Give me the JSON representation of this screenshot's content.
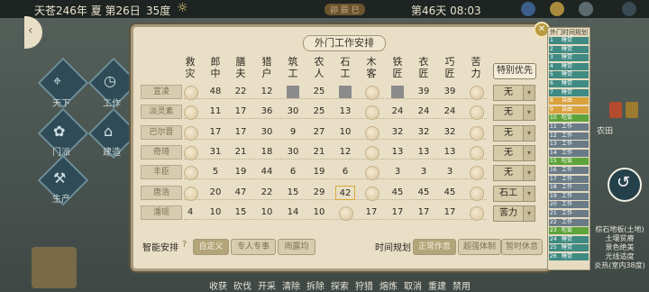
{
  "topbar": {
    "date": "天苍246年 夏 第26日",
    "temperature": "35度",
    "day_time": "第46天 08:03",
    "banner": "卯 辰 巳"
  },
  "left_nav": [
    {
      "label": "天下",
      "icon": "map-icon"
    },
    {
      "label": "工作",
      "icon": "clock-icon"
    },
    {
      "label": "门派",
      "icon": "sect-icon"
    },
    {
      "label": "建造",
      "icon": "building-icon"
    },
    {
      "label": "生产",
      "icon": "hammer-icon"
    }
  ],
  "panel": {
    "title": "外门工作安排",
    "special_header": "特别优先",
    "columns": [
      "救\n灾",
      "郎\n中",
      "膳\n夫",
      "猎\n户",
      "筑\n工",
      "农\n人",
      "石\n工",
      "木\n客",
      "铁\n匠",
      "衣\n匠",
      "巧\n匠",
      "苦\n力"
    ],
    "rows": [
      {
        "name": "宣凌",
        "values": [
          "0",
          "48",
          "22",
          "12",
          "X",
          "25",
          "X",
          "0",
          "X",
          "39",
          "39",
          "0"
        ],
        "special": "无"
      },
      {
        "name": "淡灵素",
        "values": [
          "0",
          "11",
          "17",
          "36",
          "30",
          "25",
          "13",
          "0",
          "24",
          "24",
          "24",
          "0"
        ],
        "special": "无"
      },
      {
        "name": "巴尔晋",
        "values": [
          "0",
          "17",
          "17",
          "30",
          "9",
          "27",
          "10",
          "0",
          "32",
          "32",
          "32",
          "0"
        ],
        "special": "无"
      },
      {
        "name": "奇琦",
        "values": [
          "0",
          "31",
          "21",
          "18",
          "30",
          "21",
          "12",
          "0",
          "13",
          "13",
          "13",
          "0"
        ],
        "special": "无"
      },
      {
        "name": "丰臣",
        "values": [
          "0",
          "5",
          "19",
          "44",
          "6",
          "19",
          "6",
          "0",
          "3",
          "3",
          "3",
          "0"
        ],
        "special": "无"
      },
      {
        "name": "唐浩",
        "values": [
          "0",
          "20",
          "47",
          "22",
          "15",
          "29",
          "42",
          "0",
          "45",
          "45",
          "45",
          "0"
        ],
        "special": "石工"
      },
      {
        "name": "潘瑶",
        "values": [
          "4",
          "10",
          "15",
          "10",
          "14",
          "10",
          "0",
          "17",
          "17",
          "17",
          "17",
          "0"
        ],
        "special": "苦力"
      }
    ],
    "bottom": {
      "smart_label": "智能安排",
      "smart_options": [
        "自定义",
        "专人专事",
        "雨露均"
      ],
      "time_label": "时间规划",
      "time_options": [
        "正常作息",
        "超强体制",
        "暂时休息"
      ]
    }
  },
  "schedule": {
    "title": "外门时间规划",
    "rows": [
      {
        "num": "1",
        "label": "睡觉",
        "color": "#3f8a82"
      },
      {
        "num": "2",
        "label": "睡觉",
        "color": "#3f8a82"
      },
      {
        "num": "3",
        "label": "睡觉",
        "color": "#3f8a82"
      },
      {
        "num": "4",
        "label": "睡觉",
        "color": "#3f8a82"
      },
      {
        "num": "5",
        "label": "睡觉",
        "color": "#3f8a82"
      },
      {
        "num": "6",
        "label": "睡觉",
        "color": "#3f8a82"
      },
      {
        "num": "7",
        "label": "睡觉",
        "color": "#3f8a82"
      },
      {
        "num": "8",
        "label": "自由",
        "color": "#d9a23d"
      },
      {
        "num": "9",
        "label": "自由",
        "color": "#d9a23d"
      },
      {
        "num": "10",
        "label": "吃饭",
        "color": "#5ea33c"
      },
      {
        "num": "11",
        "label": "工作",
        "color": "#6a7b87"
      },
      {
        "num": "12",
        "label": "工作",
        "color": "#6a7b87"
      },
      {
        "num": "13",
        "label": "工作",
        "color": "#6a7b87"
      },
      {
        "num": "14",
        "label": "工作",
        "color": "#6a7b87"
      },
      {
        "num": "15",
        "label": "吃饭",
        "color": "#5ea33c"
      },
      {
        "num": "16",
        "label": "工作",
        "color": "#6a7b87"
      },
      {
        "num": "17",
        "label": "工作",
        "color": "#6a7b87"
      },
      {
        "num": "18",
        "label": "工作",
        "color": "#6a7b87"
      },
      {
        "num": "19",
        "label": "工作",
        "color": "#6a7b87"
      },
      {
        "num": "20",
        "label": "工作",
        "color": "#6a7b87"
      },
      {
        "num": "21",
        "label": "工作",
        "color": "#6a7b87"
      },
      {
        "num": "22",
        "label": "工作",
        "color": "#6a7b87"
      },
      {
        "num": "23",
        "label": "吃饭",
        "color": "#5ea33c"
      },
      {
        "num": "24",
        "label": "睡觉",
        "color": "#3f8a82"
      },
      {
        "num": "25",
        "label": "睡觉",
        "color": "#3f8a82"
      },
      {
        "num": "26",
        "label": "睡觉",
        "color": "#3f8a82"
      }
    ]
  },
  "right_side": {
    "field_label": "农田",
    "info_lines": [
      "棕石地板(土地)",
      "土壤贫瘠",
      "景色绝美",
      "光线适度",
      "炎热(室内38度)"
    ]
  },
  "actionbar": [
    "收获",
    "砍伐",
    "开采",
    "清除",
    "拆除",
    "探索",
    "狩猎",
    "熔炼",
    "取消",
    "重建",
    "禁用"
  ]
}
